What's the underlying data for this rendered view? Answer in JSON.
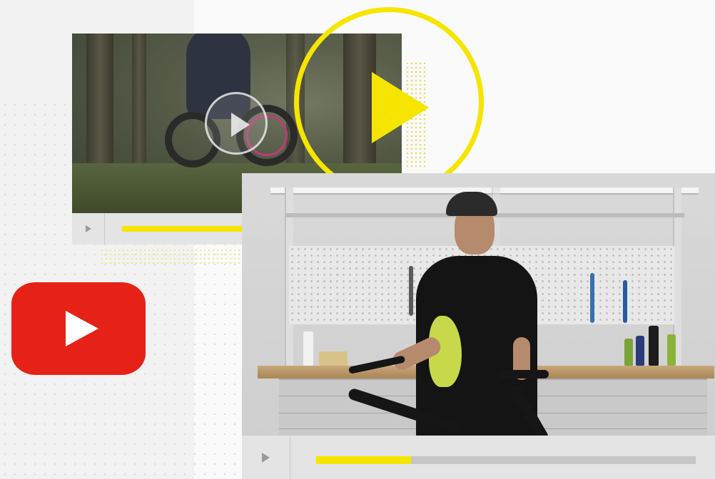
{
  "colors": {
    "accent_yellow": "#f6e500",
    "youtube_red": "#e62117",
    "control_bar": "#e4e4e4",
    "track_gray": "#c6c6c6"
  },
  "back_video": {
    "scene": "mountain-bike-forest",
    "progress": 0.46,
    "play_icon": "play-icon"
  },
  "front_video": {
    "scene": "workshop-bike-repair",
    "progress": 0.25,
    "play_icon": "play-icon"
  },
  "decorations": {
    "big_play_icon": "play-circle-icon",
    "logo_icon": "youtube-logo-icon"
  }
}
